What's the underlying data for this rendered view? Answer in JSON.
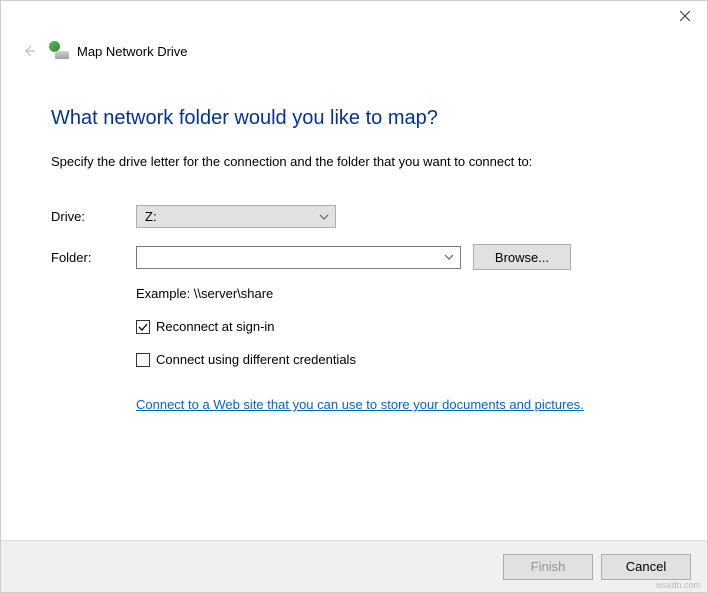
{
  "header": {
    "title": "Map Network Drive"
  },
  "main": {
    "heading": "What network folder would you like to map?",
    "instruction": "Specify the drive letter for the connection and the folder that you want to connect to:",
    "drive_label": "Drive:",
    "drive_value": "Z:",
    "folder_label": "Folder:",
    "folder_value": "",
    "browse_label": "Browse...",
    "example_text": "Example: \\\\server\\share",
    "reconnect_label": "Reconnect at sign-in",
    "reconnect_checked": true,
    "credentials_label": "Connect using different credentials",
    "credentials_checked": false,
    "link_text": "Connect to a Web site that you can use to store your documents and pictures"
  },
  "footer": {
    "finish_label": "Finish",
    "cancel_label": "Cancel"
  },
  "watermark": "wsxdn.com"
}
